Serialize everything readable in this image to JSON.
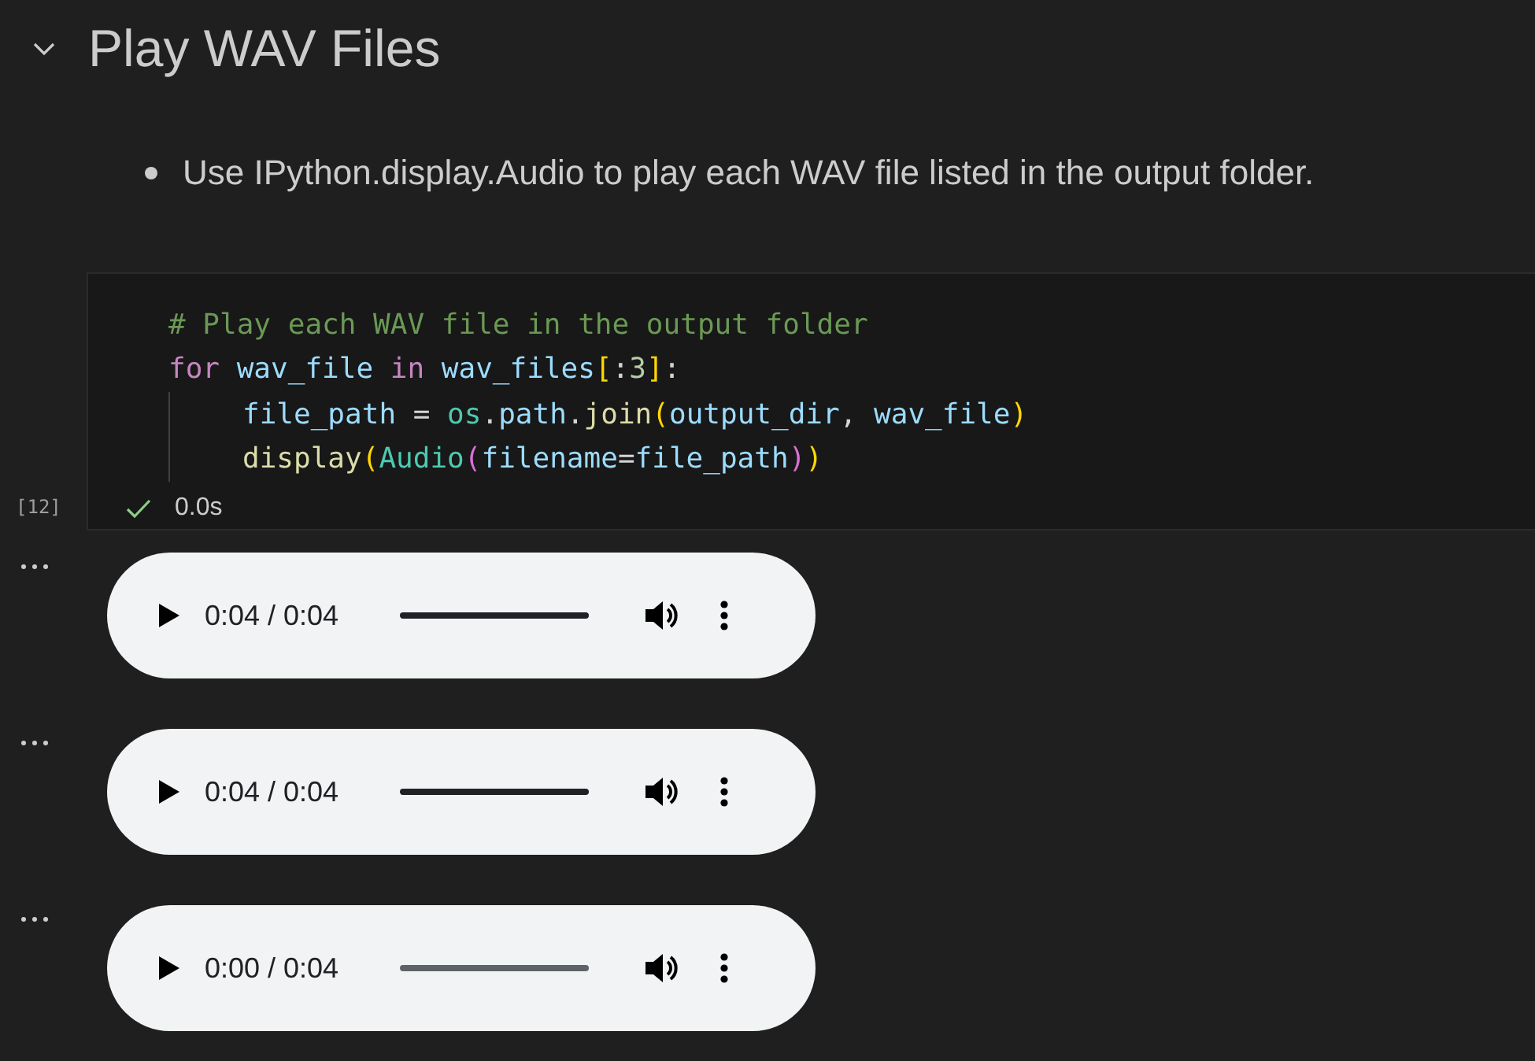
{
  "heading": {
    "title": "Play WAV Files",
    "expanded": true
  },
  "bullets": [
    "Use IPython.display.Audio to play each WAV file listed in the output folder."
  ],
  "code_cell": {
    "execution_count": "[12]",
    "duration": "0.0s",
    "lines": [
      {
        "indent_guide": false,
        "tokens": [
          {
            "kind": "comment",
            "text": "# Play each WAV file in the output folder"
          }
        ]
      },
      {
        "indent_guide": false,
        "tokens": [
          {
            "kind": "keyword",
            "text": "for"
          },
          {
            "kind": "variable",
            "text": "wav_file",
            "space_before": true
          },
          {
            "kind": "keyword",
            "text": "in",
            "space_before": true
          },
          {
            "kind": "variable",
            "text": "wav_files",
            "space_before": true
          },
          {
            "kind": "bracket1",
            "text": "["
          },
          {
            "kind": "plain",
            "text": ":"
          },
          {
            "kind": "number",
            "text": "3"
          },
          {
            "kind": "bracket1",
            "text": "]"
          },
          {
            "kind": "plain",
            "text": ":"
          }
        ]
      },
      {
        "indent_guide": true,
        "tokens": [
          {
            "kind": "variable",
            "text": "file_path"
          },
          {
            "kind": "plain",
            "text": "=",
            "space_before": true
          },
          {
            "kind": "module",
            "text": "os",
            "space_before": true
          },
          {
            "kind": "plain",
            "text": "."
          },
          {
            "kind": "variable",
            "text": "path"
          },
          {
            "kind": "plain",
            "text": "."
          },
          {
            "kind": "function",
            "text": "join"
          },
          {
            "kind": "bracket1",
            "text": "("
          },
          {
            "kind": "variable",
            "text": "output_dir"
          },
          {
            "kind": "plain",
            "text": ","
          },
          {
            "kind": "variable",
            "text": "wav_file",
            "space_before": true
          },
          {
            "kind": "bracket1",
            "text": ")"
          }
        ]
      },
      {
        "indent_guide": true,
        "tokens": [
          {
            "kind": "function",
            "text": "display"
          },
          {
            "kind": "bracket1",
            "text": "("
          },
          {
            "kind": "module",
            "text": "Audio"
          },
          {
            "kind": "bracket2",
            "text": "("
          },
          {
            "kind": "variable",
            "text": "filename"
          },
          {
            "kind": "plain",
            "text": "="
          },
          {
            "kind": "variable",
            "text": "file_path"
          },
          {
            "kind": "bracket2",
            "text": ")"
          },
          {
            "kind": "bracket1",
            "text": ")"
          }
        ]
      }
    ]
  },
  "outputs": [
    {
      "time": "0:04 / 0:04",
      "level": 1
    },
    {
      "time": "0:04 / 0:04",
      "level": 1
    },
    {
      "time": "0:00 / 0:04",
      "level": 0
    }
  ]
}
